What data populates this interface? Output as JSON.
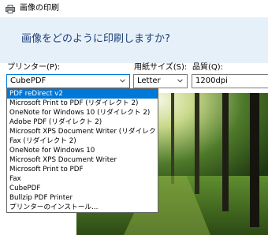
{
  "window": {
    "title": "画像の印刷"
  },
  "header": {
    "instruction": "画像をどのように印刷しますか?"
  },
  "printer": {
    "label": "プリンター(P):",
    "selected": "CubePDF"
  },
  "paper_size": {
    "label": "用紙サイズ(S):",
    "selected": "Letter"
  },
  "quality": {
    "label": "品質(Q):",
    "selected": "1200dpi"
  },
  "dropdown": {
    "items": [
      "PDF reDirect v2",
      "Microsoft Print to PDF (リダイレクト 2)",
      "OneNote for Windows 10 (リダイレクト 2)",
      "Adobe PDF (リダイレクト 2)",
      "Microsoft XPS Document Writer (リダイレクト 2)",
      "Fax (リダイレクト 2)",
      "OneNote for Windows 10",
      "Microsoft XPS Document Writer",
      "Microsoft Print to PDF",
      "Fax",
      "CubePDF",
      "Bullzip PDF Printer",
      "プリンターのインストール..."
    ],
    "highlighted_index": 0
  },
  "colors": {
    "accent": "#0078d7",
    "header_bg": "#e6f0f9",
    "instruction": "#1e3e7a"
  }
}
